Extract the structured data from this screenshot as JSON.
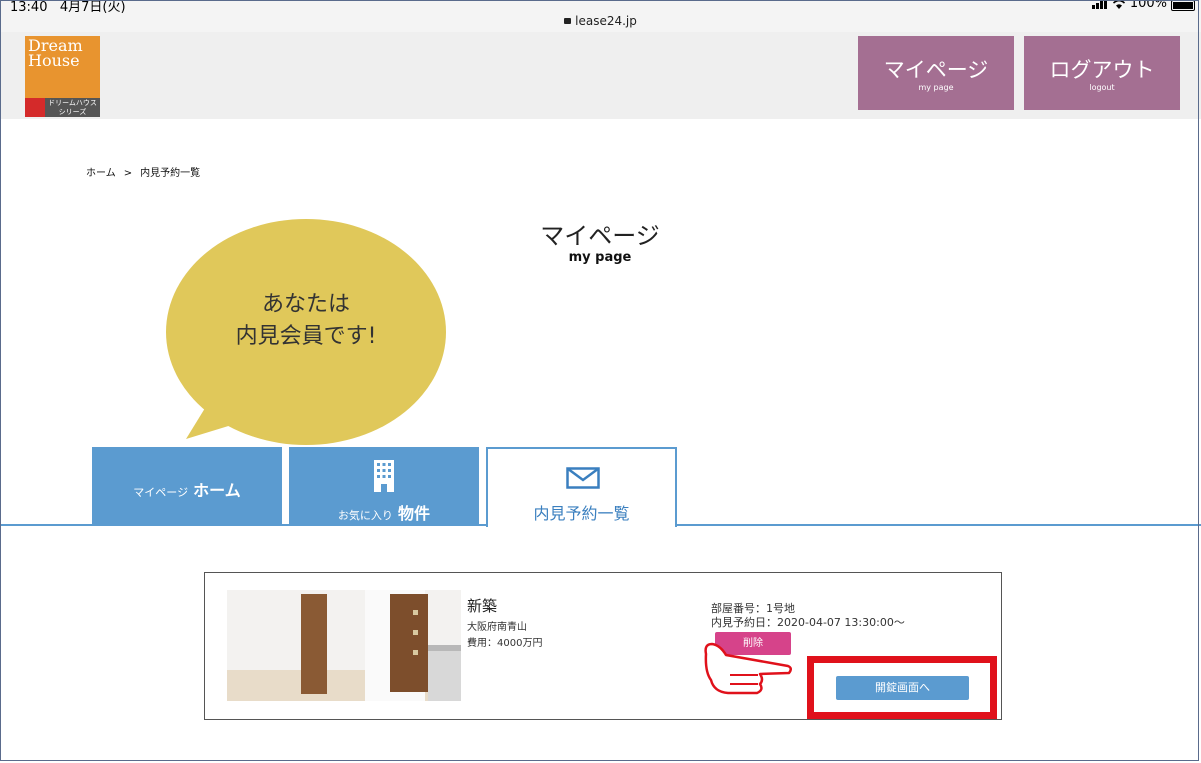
{
  "status": {
    "time": "13:40",
    "date": "4月7日(火)",
    "battery": "100%"
  },
  "browser": {
    "url": "lease24.jp"
  },
  "logo": {
    "line1": "Dream",
    "line2": "House",
    "sub1": "ドリームハウス",
    "sub2": "シリーズ"
  },
  "header": {
    "mypage_label": "マイページ",
    "mypage_sub": "my page",
    "logout_label": "ログアウト",
    "logout_sub": "logout",
    "button_color": "#a46f92"
  },
  "breadcrumb": {
    "home": "ホーム",
    "separator": ">",
    "current": "内見予約一覧"
  },
  "page": {
    "title": "マイページ",
    "subtitle": "my page"
  },
  "bubble": {
    "line1": "あなたは",
    "line2": "内見会員です!",
    "color": "#e0c85a"
  },
  "tabs": [
    {
      "small": "マイページ",
      "big": "ホーム",
      "icon": ""
    },
    {
      "small": "お気に入り",
      "big": "物件",
      "icon": "building-icon"
    },
    {
      "small": "",
      "big": "内見予約一覧",
      "icon": "mail-icon"
    }
  ],
  "reservation": {
    "name": "新築",
    "address": "大阪府南青山",
    "price": "費用：4000万円",
    "room": "部屋番号：1号地",
    "date": "内見予約日：2020-04-07 13:30:00〜",
    "delete_label": "削除",
    "unlock_label": "開錠画面へ"
  },
  "colors": {
    "accent_blue": "#5b9bd0",
    "delete_pink": "#d6438a",
    "highlight_red": "#e0111b"
  }
}
